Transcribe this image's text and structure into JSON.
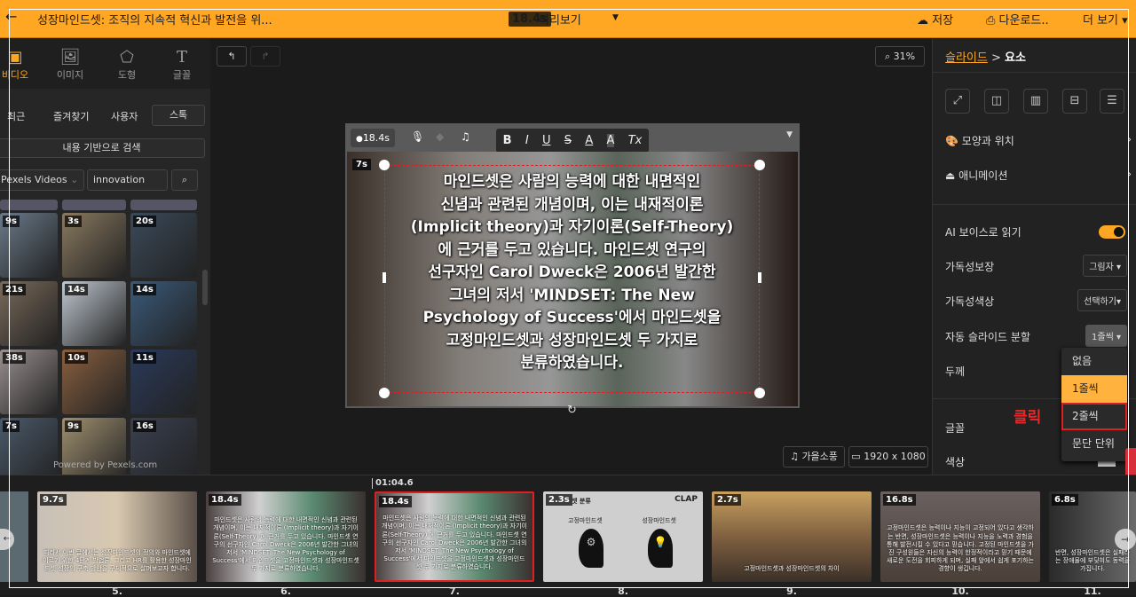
{
  "topbar": {
    "back": "←",
    "title": "성장마인드셋: 조직의 지속적 혁신과 발전을 위...",
    "duration": "18.4s",
    "preview": "미리보기",
    "save": "저장",
    "download": "다운로드..",
    "more": "더 보기"
  },
  "left": {
    "tabs": [
      {
        "label": "비디오",
        "icon": "video-icon"
      },
      {
        "label": "이미지",
        "icon": "image-icon"
      },
      {
        "label": "도형",
        "icon": "pentagon-icon"
      },
      {
        "label": "글꼴",
        "icon": "text-icon"
      }
    ],
    "subtabs": [
      "최근",
      "즐겨찾기",
      "사용자",
      "스톡"
    ],
    "content_search": "내용 기반으로 검색",
    "source": "Pexels Videos",
    "query": "innovation",
    "grid_durations": [
      "9s",
      "3s",
      "20s",
      "21s",
      "14s",
      "14s",
      "38s",
      "10s",
      "11s",
      "7s",
      "9s",
      "16s"
    ],
    "powered": "Powered by Pexels.com"
  },
  "canvas": {
    "zoom": "31%",
    "voice_duration": "18.4s",
    "slide_badge": "7s",
    "text_lines": [
      "마인드셋은 사람의 능력에 대한 내면적인",
      "신념과 관련된 개념이며, 이는 내재적이론",
      "(Implicit theory)과 자기이론(Self-Theory)",
      "에 근거를 두고 있습니다. 마인드셋 연구의",
      "선구자인 Carol Dweck은 2006년 발간한",
      "그녀의 저서 'MINDSET: The New",
      "Psychology of Success'에서 마인드셋을",
      "고정마인드셋과 성장마인드셋 두 가지로",
      "분류하였습니다."
    ],
    "format_buttons": [
      "B",
      "I",
      "U",
      "S",
      "A",
      "A",
      "Tx"
    ],
    "music": "가을소풍",
    "resolution": "1920 x 1080"
  },
  "right": {
    "breadcrumb_slide": "슬라이드",
    "breadcrumb_sep": ">",
    "breadcrumb_element": "요소",
    "shape_position": "모양과 위치",
    "animation": "애니메이션",
    "ai_voice": "AI 보이스로 읽기",
    "ai_voice_on": true,
    "readability": "가독성보장",
    "readability_value": "그림자",
    "readability_color": "가독성색상",
    "readability_color_value": "선택하기",
    "auto_split": "자동 슬라이드 분할",
    "auto_split_value": "1줄씩",
    "thickness": "두께",
    "font": "글꼴",
    "color": "색상",
    "dropdown_options": [
      "없음",
      "1줄씩",
      "2줄씩",
      "문단 단위"
    ],
    "click_annotation": "클릭",
    "accent": "#ffa722"
  },
  "timeline": {
    "playhead": "01:04.6",
    "slides": [
      {
        "num": "5.",
        "dur": "9.7s",
        "text": "따라서 이번 글에서는 성장마인드셋의 정의와 마인드셋에 이르기 위한 4단계 방법론, 그리고 HR를 활용한 성장마인드셋 성장의 구축 방안을 구체적으로 살펴보고자 합니다."
      },
      {
        "num": "6.",
        "dur": "18.4s",
        "text": "마인드셋은 사람의 능력에 대한 내면적인 신념과 관련된 개념이며, 이는 내재적이론 (Implicit theory)과 자기이론(Self-Theory) 에 근거를 두고 있습니다. 마인드셋 연구의 선구자인 Carol Dweck은 2006년 발간한 그녀의 저서 'MINDSET: The New Psychology of Success'에서 마인드셋을 고정마인드셋과 성장마인드셋 두 가지로 분류하였습니다."
      },
      {
        "num": "7.",
        "dur": "18.4s",
        "text": "마인드셋은 사람의 능력에 대한 내면적인 신념과 관련된 개념이며, 이는 내재적이론 (Implicit theory)과 자기이론(Self-Theory) 에 근거를 두고 있습니다. 마인드셋 연구의 선구자인 Carol Dweck은 2006년 발간한 그녀의 저서 'MINDSET: The New Psychology of Success'에서 마인드셋을 고정마인드셋과 성장마인드셋 두 가지로 분류하였습니다."
      },
      {
        "num": "8.",
        "dur": "2.3s",
        "title": "셋 분류",
        "left": "고정마인드셋",
        "right": "성장마인드셋",
        "logo": "CLAP"
      },
      {
        "num": "9.",
        "dur": "2.7s",
        "text": "고정마인드셋과 성장마인드셋의 차이"
      },
      {
        "num": "10.",
        "dur": "16.8s",
        "text": "고정마인드셋은 능력이나 지능이 고정되어 있다고 생각하는 반면, 성장마인드셋은 능력이나 지능을 노력과 경험을 통해 발전시킬 수 있다고 믿습니다. 고정된 마인드셋을 가진 구성원들은 자신의 능력이 한정적이라고 믿기 때문에 새로운 도전을 회피하게 되며, 실패 앞에서 쉽게 포기하는 경향이 생깁니다."
      },
      {
        "num": "11.",
        "dur": "6.8s",
        "text": "반면, 성장마인드셋은 실패라는 장애물에 부딪혀도 동력을 가집니다."
      }
    ]
  }
}
